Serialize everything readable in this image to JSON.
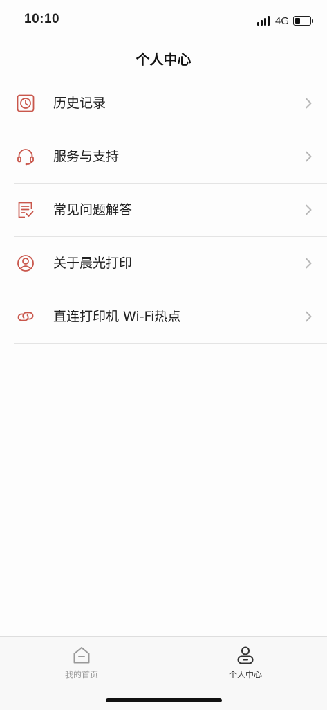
{
  "status_bar": {
    "time": "10:10",
    "network": "4G",
    "battery_level": 0.35
  },
  "header": {
    "title": "个人中心"
  },
  "menu": {
    "items": [
      {
        "label": "历史记录",
        "icon": "history-clock-icon"
      },
      {
        "label": "服务与支持",
        "icon": "headset-icon"
      },
      {
        "label": "常见问题解答",
        "icon": "faq-checklist-icon"
      },
      {
        "label": "关于晨光打印",
        "icon": "user-circle-icon"
      },
      {
        "label": "直连打印机 Wi-Fi热点",
        "icon": "link-icon"
      }
    ]
  },
  "tab_bar": {
    "tabs": [
      {
        "label": "我的首页",
        "icon": "home-icon",
        "active": false
      },
      {
        "label": "个人中心",
        "icon": "person-icon",
        "active": true
      }
    ]
  },
  "colors": {
    "accent": "#c9574c",
    "chevron": "#b8b8b8",
    "divider": "#e4e4e4",
    "tab_inactive": "#9a9a9a",
    "tab_active": "#333333"
  }
}
